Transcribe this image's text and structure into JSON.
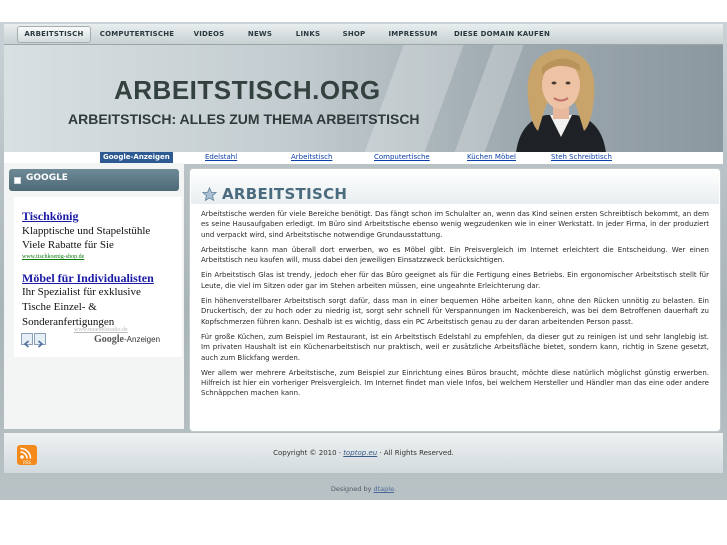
{
  "nav": {
    "items": [
      {
        "label": "ARBEITSTISCH",
        "active": true
      },
      {
        "label": "COMPUTERTISCHE",
        "active": false
      },
      {
        "label": "VIDEOS",
        "active": false
      },
      {
        "label": "NEWS",
        "active": false
      },
      {
        "label": "LINKS",
        "active": false
      },
      {
        "label": "SHOP",
        "active": false
      },
      {
        "label": "IMPRESSUM",
        "active": false
      },
      {
        "label": "DIESE DOMAIN KAUFEN",
        "active": false
      }
    ]
  },
  "header": {
    "title": "ARBEITSTISCH.ORG",
    "subtitle": "ARBEITSTISCH: ALLES ZUM THEMA ARBEITSTISCH"
  },
  "adlinks": {
    "label": "Google-Anzeigen",
    "links": [
      "Edelstahl",
      "Arbeitstisch",
      "Computertische",
      "Küchen Möbel",
      "Steh Schreibtisch"
    ]
  },
  "sidebar": {
    "heading": "GOOGLE",
    "ads": [
      {
        "title": "Tischkönig",
        "lines": [
          "Klapptische und Stapelstühle",
          "Viele Rabatte für Sie"
        ],
        "url": "www.tischkoenig-shop.de"
      },
      {
        "title": "Möbel für Individualisten",
        "lines": [
          "Ihr Spezialist für exklusive",
          "Tische Einzel- &",
          "Sonderanfertigungen"
        ],
        "url": "www.moebelstudio.de"
      }
    ],
    "google_mark": "Google",
    "google_suffix": "-Anzeigen"
  },
  "content": {
    "title": "ARBEITSTISCH",
    "paragraphs": [
      "Arbeitstische werden für viele Bereiche benötigt. Das fängt schon im Schulalter an, wenn das Kind seinen ersten Schreibtisch bekommt, an dem es seine Hausaufgaben erledigt. Im Büro sind Arbeitstische ebenso wenig wegzudenken wie in einer Werkstatt. In jeder Firma, in der produziert und verpackt wird, sind Arbeitstische notwendige Grundausstattung.",
      "Arbeitstische kann man überall dort erwerben, wo es Möbel gibt. Ein Preisvergleich im Internet erleichtert die Entscheidung. Wer einen Arbeitstisch neu kaufen will, muss dabei den jeweiligen Einsatzzweck berücksichtigen.",
      "Ein Arbeitstisch Glas ist trendy, jedoch eher für das Büro geeignet als für die Fertigung eines Betriebs. Ein ergonomischer Arbeitstisch stellt für Leute, die viel im Sitzen oder gar im Stehen arbeiten müssen, eine ungeahnte Erleichterung dar.",
      "Ein höhenverstellbarer Arbeitstisch sorgt dafür, dass man in einer bequemen Höhe arbeiten kann, ohne den Rücken unnötig zu belasten. Ein Druckertisch, der zu hoch oder zu niedrig ist, sorgt sehr schnell für Verspannungen im Nackenbereich, was bei dem Betroffenen dauerhaft zu Kopfschmerzen führen kann. Deshalb ist es wichtig, dass ein PC Arbeitstisch genau zu der daran arbeitenden Person passt.",
      "Für große Küchen, zum Beispiel im Restaurant, ist ein Arbeitstisch Edelstahl zu empfehlen, da dieser gut zu reinigen ist und sehr langlebig ist. Im privaten Haushalt ist ein Küchenarbeitstisch nur praktisch, weil er zusätzliche Arbeitsfläche bietet, sondern kann, richtig in Szene gesetzt, auch zum Blickfang werden.",
      "Wer allem wer mehrere Arbeitstische, zum Beispiel zur Einrichtung eines Büros braucht, möchte diese natürlich möglichst günstig erwerben. Hilfreich ist hier ein vorheriger Preisvergleich. Im Internet findet man viele Infos, bei welchem Hersteller und Händler man das eine oder andere Schnäppchen machen kann."
    ]
  },
  "footer": {
    "copyright_prefix": "Copyright © 2010 · ",
    "copyright_link": "toptop.eu",
    "copyright_suffix": " · All Rights Reserved.",
    "rss_label": "RSS",
    "designed_prefix": "Designed by ",
    "designed_link": "dtaple",
    "designed_suffix": "."
  },
  "colors": {
    "title": "#33413f",
    "content_title": "#4b6b7e",
    "ad_link": "#1a1aa6",
    "ad_url": "#0b7a0b",
    "adlink_blue": "#0b3fa8",
    "ad_label_bg": "#2d5a93",
    "rss": "#f48a1c"
  },
  "icons": {
    "content_heading": "star-icon",
    "footer": "rss-icon",
    "sidebar_heading": "square-bullet-icon"
  }
}
